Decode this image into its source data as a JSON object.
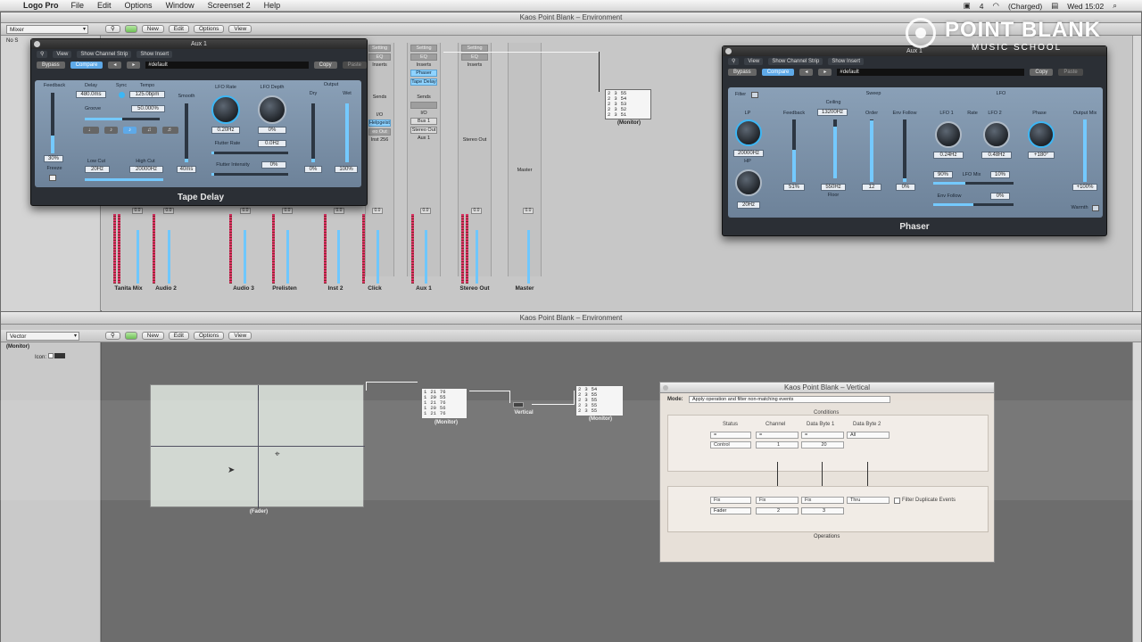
{
  "menubar": {
    "app": "Logo Pro",
    "items": [
      "File",
      "Edit",
      "Options",
      "Window",
      "Screenset 2",
      "Help"
    ],
    "status": {
      "battery": "(Charged)",
      "clock": "Wed 15:02",
      "count": "4"
    }
  },
  "logo": {
    "name": "POINT BLANK",
    "sub": "MUSIC SCHOOL"
  },
  "top_env": {
    "title": "Kaos Point Blank – Environment",
    "layer": "Mixer",
    "toolbar": [
      "New",
      "Edit",
      "Options",
      "View"
    ],
    "inspector_item": "No S",
    "strips": [
      {
        "label": "Setting",
        "eq": "EQ",
        "inserts": "Inserts"
      },
      {
        "label": "Setting",
        "eq": "EQ",
        "inserts": "Inserts",
        "slot1": "Phaser",
        "slot2": "Tape Delay",
        "sends": "Sends",
        "io": "I/O",
        "bus": "Bus 1",
        "out": "Stereo Out",
        "name": "Aux 1"
      },
      {
        "label": "Setting",
        "eq": "EQ",
        "inserts": "Inserts",
        "name": "Stereo Out"
      }
    ],
    "partial_strip": {
      "sends": "Sends",
      "io": "I/O",
      "input": "Helpgeist",
      "out": "eo Out",
      "inst": "Inst 256"
    },
    "master": "Master",
    "off_labels": [
      "Off",
      "Off",
      "Off"
    ],
    "channel_names": [
      "Tanita Mix",
      "Audio 2",
      "Audio 3",
      "Prelisten",
      "Inst 2",
      "Click",
      "Aux 1",
      "Stereo Out",
      "Master"
    ],
    "fader_values": [
      "0.0",
      "0.0",
      "0.0",
      "0.0",
      "0.0",
      "0.0",
      "0.0",
      "0.0",
      "0.0"
    ],
    "monitor": {
      "rows": [
        [
          "2",
          "3",
          "55"
        ],
        [
          "2",
          "3",
          "54"
        ],
        [
          "2",
          "3",
          "53"
        ],
        [
          "2",
          "3",
          "52"
        ],
        [
          "2",
          "3",
          "51"
        ]
      ],
      "label": "(Monitor)"
    }
  },
  "tape_delay": {
    "title": "Aux 1",
    "menu": [
      "View",
      "Show Channel Strip",
      "Show Insert"
    ],
    "bypass": "Bypass",
    "compare": "Compare",
    "preset": "#default",
    "copy": "Copy",
    "paste": "Paste",
    "labels": {
      "feedback": "Feedback",
      "delay": "Delay",
      "sync": "Sync",
      "tempo": "Tempo",
      "groove": "Groove",
      "smooth": "Smooth",
      "lfo_rate": "LFO Rate",
      "lfo_depth": "LFO Depth",
      "flutter_rate": "Flutter Rate",
      "flutter_int": "Flutter Intensity",
      "low_cut": "Low Cut",
      "high_cut": "High Cut",
      "freeze": "Freeze",
      "output": "Output",
      "dry": "Dry",
      "wet": "Wet"
    },
    "values": {
      "feedback": "30%",
      "delay": "480.0ms",
      "tempo": "125.0bpm",
      "groove": "50.000%",
      "smooth": "40ms",
      "lfo_rate": "0.20Hz",
      "lfo_depth": "0%",
      "flutter_rate": "0.0Hz",
      "flutter_int": "0%",
      "low_cut": "20Hz",
      "high_cut": "20000Hz",
      "dry": "0%",
      "wet": "100%"
    },
    "name": "Tape Delay"
  },
  "phaser": {
    "title": "Aux 1",
    "menu": [
      "View",
      "Show Channel Strip",
      "Show Insert"
    ],
    "bypass": "Bypass",
    "compare": "Compare",
    "preset": "#default",
    "copy": "Copy",
    "paste": "Paste",
    "labels": {
      "filter": "Filter",
      "lp": "LP",
      "hp": "HP",
      "feedback": "Feedback",
      "sweep": "Sweep",
      "ceiling": "Ceiling",
      "floor": "Floor",
      "order": "Order",
      "env_follow": "Env Follow",
      "lfo": "LFO",
      "lfo1": "LFO 1",
      "rate": "Rate",
      "lfo2": "LFO 2",
      "phase": "Phase",
      "lfo_mix": "LFO Mix",
      "env_follow2": "Env Follow",
      "output_mix": "Output Mix",
      "warmth": "Warmth"
    },
    "values": {
      "lp": "20000Hz",
      "hp": "20Hz",
      "feedback": "51%",
      "ceiling": "13200Hz",
      "floor": "550Hz",
      "order": "12",
      "env_follow": "0%",
      "lfo1": "0.24Hz",
      "lfo2": "0.48Hz",
      "phase": "+180°",
      "lfo_mix_a": "90%",
      "lfo_mix_b": "10%",
      "env_follow2": "0%",
      "output_mix": "+100%"
    },
    "name": "Phaser"
  },
  "bot_env": {
    "title": "Kaos Point Blank – Environment",
    "layer": "Vector",
    "toolbar": [
      "New",
      "Edit",
      "Options",
      "View"
    ],
    "inspector": {
      "object": "(Monitor)",
      "icon_label": "Icon:"
    },
    "vector_label": "(Fader)",
    "monitor1": {
      "rows": [
        [
          "1",
          "21",
          "76"
        ],
        [
          "1",
          "20",
          "55"
        ],
        [
          "1",
          "21",
          "76"
        ],
        [
          "1",
          "20",
          "56"
        ],
        [
          "1",
          "21",
          "76"
        ]
      ],
      "label": "(Monitor)"
    },
    "vertical_label": "Vertical",
    "monitor2": {
      "rows": [
        [
          "2",
          "3",
          "54"
        ],
        [
          "2",
          "3",
          "55"
        ],
        [
          "2",
          "3",
          "55"
        ],
        [
          "2",
          "3",
          "55"
        ],
        [
          "2",
          "3",
          "55"
        ]
      ],
      "label": "(Monitor)"
    }
  },
  "transformer": {
    "title": "Kaos Point Blank – Vertical",
    "mode_label": "Mode:",
    "mode_value": "Apply operation and filter non-matching events",
    "conditions": "Conditions",
    "cond_headers": [
      "Status",
      "Channel",
      "Data Byte 1",
      "Data Byte 2"
    ],
    "cond_row1": [
      "=",
      "=",
      "=",
      "All"
    ],
    "cond_row2": [
      "Control",
      "1",
      "20"
    ],
    "ops_row1": [
      "Fix",
      "Fix",
      "Fix",
      "Thru"
    ],
    "ops_row2": [
      "Fader",
      "2",
      "3"
    ],
    "filter_dup": "Filter Duplicate Events",
    "operations": "Operations"
  }
}
